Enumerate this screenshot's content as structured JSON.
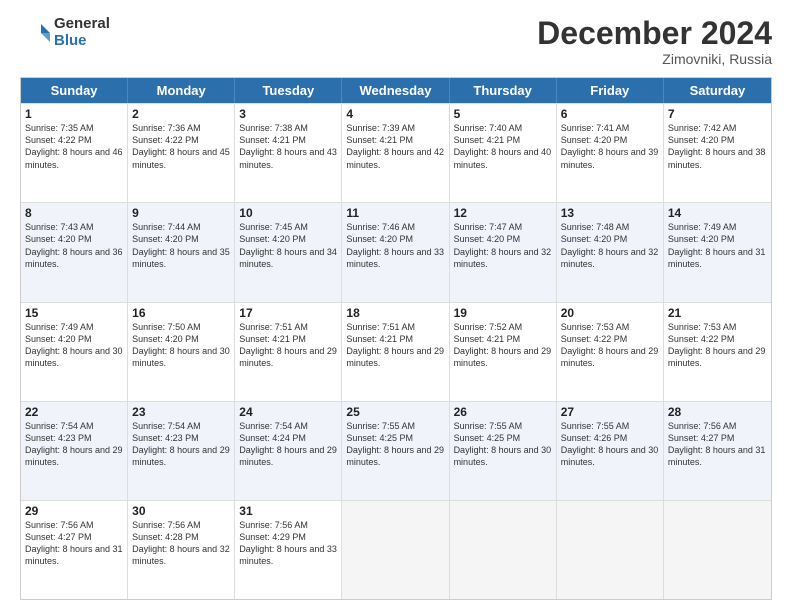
{
  "logo": {
    "general": "General",
    "blue": "Blue"
  },
  "title": "December 2024",
  "subtitle": "Zimovniki, Russia",
  "days": [
    "Sunday",
    "Monday",
    "Tuesday",
    "Wednesday",
    "Thursday",
    "Friday",
    "Saturday"
  ],
  "weeks": [
    [
      {
        "day": "1",
        "sunrise": "7:35 AM",
        "sunset": "4:22 PM",
        "daylight": "8 hours and 46 minutes."
      },
      {
        "day": "2",
        "sunrise": "7:36 AM",
        "sunset": "4:22 PM",
        "daylight": "8 hours and 45 minutes."
      },
      {
        "day": "3",
        "sunrise": "7:38 AM",
        "sunset": "4:21 PM",
        "daylight": "8 hours and 43 minutes."
      },
      {
        "day": "4",
        "sunrise": "7:39 AM",
        "sunset": "4:21 PM",
        "daylight": "8 hours and 42 minutes."
      },
      {
        "day": "5",
        "sunrise": "7:40 AM",
        "sunset": "4:21 PM",
        "daylight": "8 hours and 40 minutes."
      },
      {
        "day": "6",
        "sunrise": "7:41 AM",
        "sunset": "4:20 PM",
        "daylight": "8 hours and 39 minutes."
      },
      {
        "day": "7",
        "sunrise": "7:42 AM",
        "sunset": "4:20 PM",
        "daylight": "8 hours and 38 minutes."
      }
    ],
    [
      {
        "day": "8",
        "sunrise": "7:43 AM",
        "sunset": "4:20 PM",
        "daylight": "8 hours and 36 minutes."
      },
      {
        "day": "9",
        "sunrise": "7:44 AM",
        "sunset": "4:20 PM",
        "daylight": "8 hours and 35 minutes."
      },
      {
        "day": "10",
        "sunrise": "7:45 AM",
        "sunset": "4:20 PM",
        "daylight": "8 hours and 34 minutes."
      },
      {
        "day": "11",
        "sunrise": "7:46 AM",
        "sunset": "4:20 PM",
        "daylight": "8 hours and 33 minutes."
      },
      {
        "day": "12",
        "sunrise": "7:47 AM",
        "sunset": "4:20 PM",
        "daylight": "8 hours and 32 minutes."
      },
      {
        "day": "13",
        "sunrise": "7:48 AM",
        "sunset": "4:20 PM",
        "daylight": "8 hours and 32 minutes."
      },
      {
        "day": "14",
        "sunrise": "7:49 AM",
        "sunset": "4:20 PM",
        "daylight": "8 hours and 31 minutes."
      }
    ],
    [
      {
        "day": "15",
        "sunrise": "7:49 AM",
        "sunset": "4:20 PM",
        "daylight": "8 hours and 30 minutes."
      },
      {
        "day": "16",
        "sunrise": "7:50 AM",
        "sunset": "4:20 PM",
        "daylight": "8 hours and 30 minutes."
      },
      {
        "day": "17",
        "sunrise": "7:51 AM",
        "sunset": "4:21 PM",
        "daylight": "8 hours and 29 minutes."
      },
      {
        "day": "18",
        "sunrise": "7:51 AM",
        "sunset": "4:21 PM",
        "daylight": "8 hours and 29 minutes."
      },
      {
        "day": "19",
        "sunrise": "7:52 AM",
        "sunset": "4:21 PM",
        "daylight": "8 hours and 29 minutes."
      },
      {
        "day": "20",
        "sunrise": "7:53 AM",
        "sunset": "4:22 PM",
        "daylight": "8 hours and 29 minutes."
      },
      {
        "day": "21",
        "sunrise": "7:53 AM",
        "sunset": "4:22 PM",
        "daylight": "8 hours and 29 minutes."
      }
    ],
    [
      {
        "day": "22",
        "sunrise": "7:54 AM",
        "sunset": "4:23 PM",
        "daylight": "8 hours and 29 minutes."
      },
      {
        "day": "23",
        "sunrise": "7:54 AM",
        "sunset": "4:23 PM",
        "daylight": "8 hours and 29 minutes."
      },
      {
        "day": "24",
        "sunrise": "7:54 AM",
        "sunset": "4:24 PM",
        "daylight": "8 hours and 29 minutes."
      },
      {
        "day": "25",
        "sunrise": "7:55 AM",
        "sunset": "4:25 PM",
        "daylight": "8 hours and 29 minutes."
      },
      {
        "day": "26",
        "sunrise": "7:55 AM",
        "sunset": "4:25 PM",
        "daylight": "8 hours and 30 minutes."
      },
      {
        "day": "27",
        "sunrise": "7:55 AM",
        "sunset": "4:26 PM",
        "daylight": "8 hours and 30 minutes."
      },
      {
        "day": "28",
        "sunrise": "7:56 AM",
        "sunset": "4:27 PM",
        "daylight": "8 hours and 31 minutes."
      }
    ],
    [
      {
        "day": "29",
        "sunrise": "7:56 AM",
        "sunset": "4:27 PM",
        "daylight": "8 hours and 31 minutes."
      },
      {
        "day": "30",
        "sunrise": "7:56 AM",
        "sunset": "4:28 PM",
        "daylight": "8 hours and 32 minutes."
      },
      {
        "day": "31",
        "sunrise": "7:56 AM",
        "sunset": "4:29 PM",
        "daylight": "8 hours and 33 minutes."
      },
      null,
      null,
      null,
      null
    ]
  ]
}
